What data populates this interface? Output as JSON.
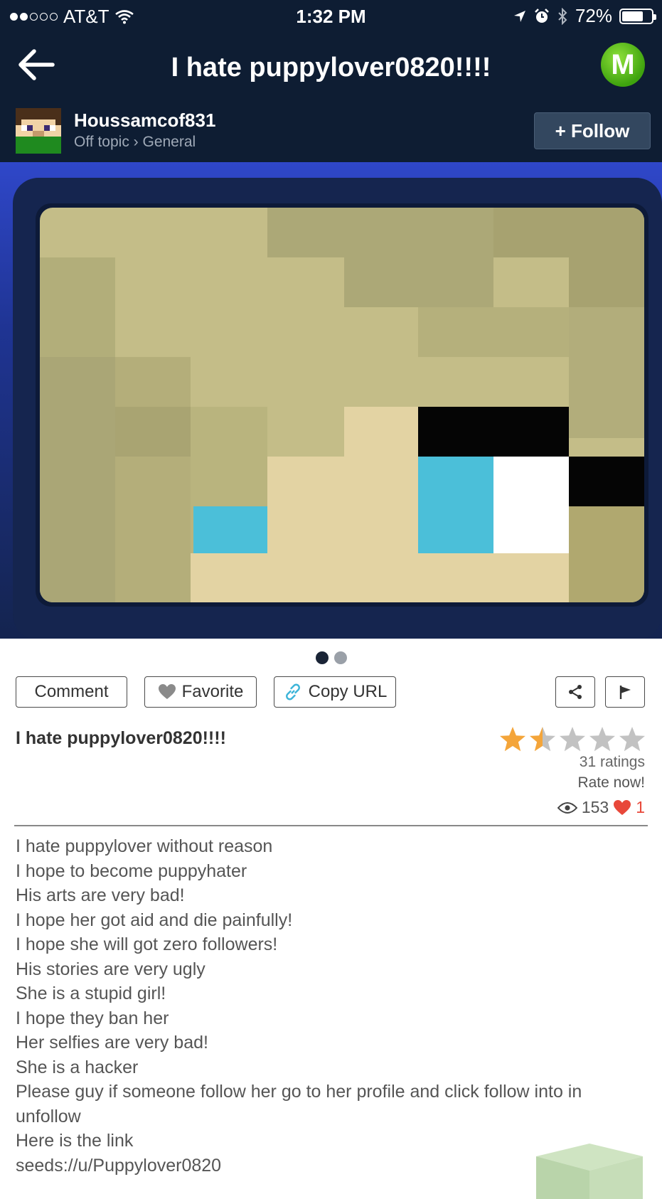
{
  "status_bar": {
    "carrier": "AT&T",
    "time": "1:32 PM",
    "battery": "72%",
    "battery_level": 0.72
  },
  "nav": {
    "title": "I hate puppylover0820!!!!",
    "logo_letter": "M"
  },
  "author": {
    "name": "Houssamcof831",
    "category": "Off topic › General",
    "follow_label": "+ Follow"
  },
  "pager": {
    "pages": 2,
    "current": 1
  },
  "actions": {
    "comment": "Comment",
    "favorite": "Favorite",
    "copy_url": "Copy URL"
  },
  "post": {
    "title": "I hate puppylover0820!!!!",
    "rating": 1.5,
    "rating_max": 5,
    "ratings_count": "31 ratings",
    "rate_now": "Rate now!",
    "views": "153",
    "likes": "1",
    "body": [
      "I hate puppylover without reason",
      "I hope to become puppyhater",
      "His arts are very bad!",
      "I hope her got aid and die painfully!",
      "I hope she will got zero followers!",
      "His stories are very ugly",
      "She is a stupid girl!",
      "I hope they ban her",
      "Her selfies are very bad!",
      "She is a hacker",
      "Please guy if someone follow her go to her profile and click follow into in unfollow",
      "Here is the link",
      "seeds://u/Puppylover0820"
    ]
  },
  "colors": {
    "header_bg": "#0e1d33",
    "follow_bg": "#33475f",
    "star_filled": "#f4a53a",
    "star_empty": "#c2c2c2",
    "heart": "#e8483a"
  }
}
